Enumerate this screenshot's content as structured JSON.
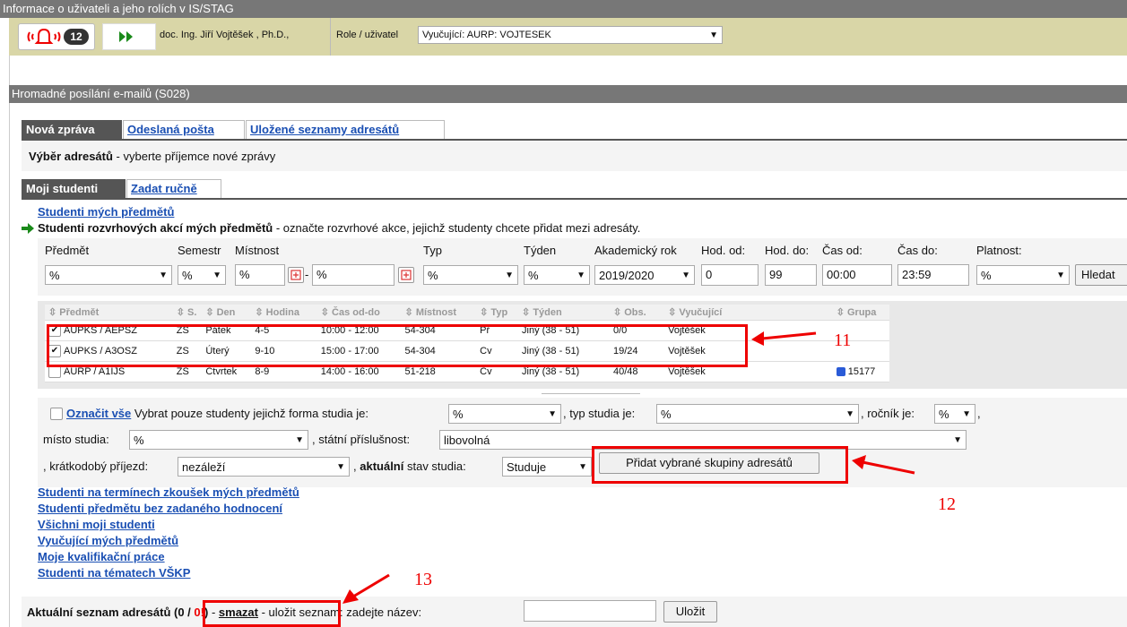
{
  "header": {
    "title": "Informace o uživateli a jeho rolích v IS/STAG",
    "notif_count": "12",
    "user_name": "doc. Ing. Jiří Vojtěšek , Ph.D.,",
    "role_label": "Role / uživatel",
    "role_value": "Vyučující: AURP: VOJTESEK"
  },
  "section": {
    "title": "Hromadné posílání e-mailů (S028)"
  },
  "tabs": [
    "Nová zpráva",
    "Odeslaná pošta",
    "Uložené seznamy adresátů"
  ],
  "vyber": {
    "bold": "Výběr adresátů",
    "rest": " - vyberte příjemce nové zprávy"
  },
  "subtabs": [
    "Moji studenti",
    "Zadat ručně"
  ],
  "students_link": "Studenti mých předmětů",
  "rozvrh": {
    "bold": "Studenti rozvrhových akcí mých předmětů",
    "rest": " - označte rozvrhové akce, jejichž studenty chcete přidat mezi adresáty."
  },
  "filters": {
    "labels": [
      "Předmět",
      "Semestr",
      "Místnost",
      "Typ",
      "Týden",
      "Akademický rok",
      "Hod. od:",
      "Hod. do:",
      "Čas od:",
      "Čas do:",
      "Platnost:"
    ],
    "predmet": "%",
    "semestr": "%",
    "mistnost1": "%",
    "dash": "-",
    "mistnost2": "%",
    "typ": "%",
    "tyden": "%",
    "rok": "2019/2020",
    "hod_od": "0",
    "hod_do": "99",
    "cas_od": "00:00",
    "cas_do": "23:59",
    "platnost": "%",
    "search_button": "Hledat"
  },
  "table": {
    "headers": [
      "Předmět",
      "S.",
      "Den",
      "Hodina",
      "Čas od-do",
      "Místnost",
      "Typ",
      "Týden",
      "Obs.",
      "Vyučující",
      "Grupa"
    ],
    "rows": [
      [
        "AUPKS / AEPSZ",
        "ZS",
        "Pátek",
        "4-5",
        "10:00 - 12:00",
        "54-304",
        "Př",
        "Jiný (38 - 51)",
        "0/0",
        "Vojtěšek",
        ""
      ],
      [
        "AUPKS / A3OSZ",
        "ZS",
        "Úterý",
        "9-10",
        "15:00 - 17:00",
        "54-304",
        "Cv",
        "Jiný (38 - 51)",
        "19/24",
        "Vojtěšek",
        ""
      ],
      [
        "AURP / A1IJS",
        "ZS",
        "Čtvrtek",
        "8-9",
        "14:00 - 16:00",
        "51-218",
        "Cv",
        "Jiný (38 - 51)",
        "40/48",
        "Vojtěšek",
        "15177"
      ]
    ],
    "checked": [
      true,
      true,
      false
    ]
  },
  "bulk": {
    "select_all": "Označit vše",
    "text1": " Vybrat pouze studenty jejichž forma studia je:",
    "forma": "%",
    "text2": ", typ studia je:",
    "typ": "%",
    "text3": ", ročník je:",
    "rocnik": "%",
    "text3b": ",",
    "misto_label": "místo studia:",
    "misto": "%",
    "statni_label": ", státní příslušnost:",
    "statni": "libovolná",
    "kratko_label": ", krátkodobý příjezd:",
    "kratko": "nezáleží",
    "aktualni_pre": ", ",
    "aktualni_bold": "aktuální",
    "aktualni_post": " stav studia:",
    "stav": "Studuje",
    "add_button": "Přidat vybrané skupiny adresátů"
  },
  "links": [
    "Studenti na termínech zkoušek mých předmětů",
    "Studenti předmětu bez zadaného hodnocení",
    "Všichni moji studenti",
    "Vyučující mých předmětů",
    "Moje kvalifikační práce",
    "Studenti na tématech VŠKP"
  ],
  "footer": {
    "label": "Aktuální seznam adresátů",
    "count_open": "(0 / ",
    "count_red": "0",
    "count_bang": "!",
    "count_close": ")",
    "dash1": " - ",
    "delete": "smazat",
    "rest": " - uložit seznam: zadejte název:",
    "save_button": "Uložit"
  },
  "annotations": [
    "11",
    "12",
    "13"
  ]
}
